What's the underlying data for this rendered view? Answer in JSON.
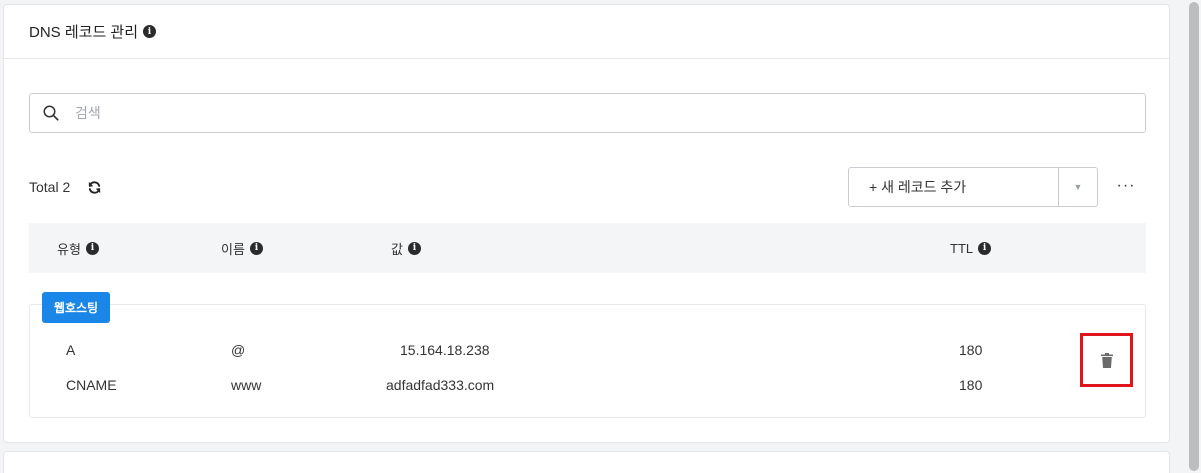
{
  "card": {
    "title": "DNS 레코드 관리",
    "info_icon": "info-icon"
  },
  "search": {
    "placeholder": "검색",
    "value": ""
  },
  "toolbar": {
    "total_label": "Total 2",
    "add_label": "+ 새 레코드 추가",
    "caret": "▼",
    "more": "···"
  },
  "table": {
    "headers": {
      "type": "유형",
      "name": "이름",
      "value": "값",
      "ttl": "TTL"
    },
    "group_badge": "웹호스팅",
    "rows": [
      {
        "type": "A",
        "name": "@",
        "value": "15.164.18.238",
        "ttl": "180"
      },
      {
        "type": "CNAME",
        "name": "www",
        "value": "adfadfad333.com",
        "ttl": "180"
      }
    ]
  },
  "next_card": {
    "title": "",
    "visible": true
  },
  "colors": {
    "accent": "#1a86e8",
    "highlight": "#e0141c",
    "header_bg": "#f4f5f7"
  }
}
